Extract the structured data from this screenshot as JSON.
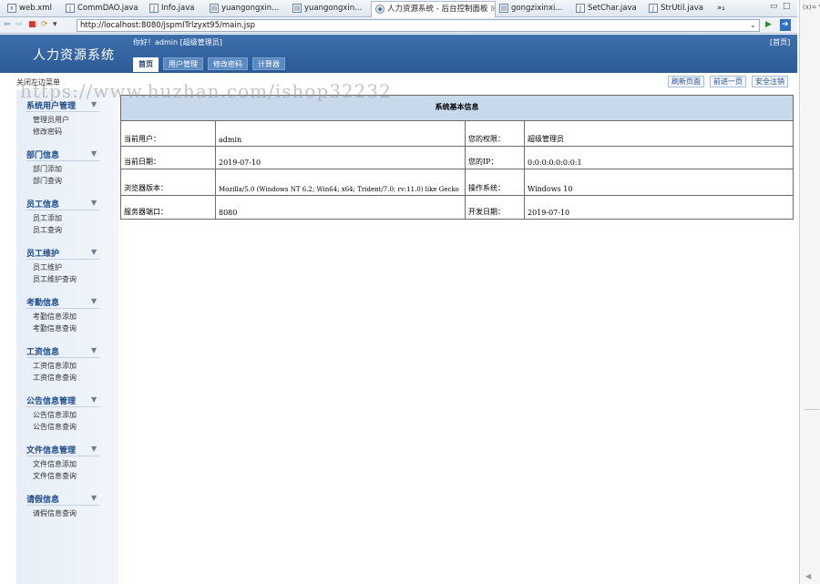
{
  "editor_tabs": [
    {
      "label": "web.xml",
      "icon": "x-icon"
    },
    {
      "label": "CommDAO.java",
      "icon": "j-icon"
    },
    {
      "label": "Info.java",
      "icon": "j-icon"
    },
    {
      "label": "yuangongxin...",
      "icon": "file-icon"
    },
    {
      "label": "yuangongxin...",
      "icon": "file-icon"
    },
    {
      "label": "人力资源系统 - 后台控制面板",
      "icon": "globe-icon",
      "active": true
    },
    {
      "label": "gongzixinxi...",
      "icon": "file-icon"
    },
    {
      "label": "SetChar.java",
      "icon": "j-icon"
    },
    {
      "label": "StrUtil.java",
      "icon": "j-icon"
    },
    {
      "label": "»₂",
      "icon": ""
    }
  ],
  "right_panel_label": "(x)= V",
  "address": {
    "url": "http://localhost:8080/jspmITrlzyxt95/main.jsp"
  },
  "header": {
    "brand": "人力资源系统",
    "greeting": "你好！admin [超级管理员]",
    "home_link": "[首页]",
    "nav_tabs": [
      "首页",
      "用户管理",
      "修改密码",
      "计算器"
    ]
  },
  "utility": {
    "close_menu": "关闭左边菜单",
    "refresh": "刷新页面",
    "back": "前进一页",
    "logout": "安全注销"
  },
  "watermark": "https://www.huzhan.com/ishop32232",
  "sidebar": [
    {
      "title": "系统用户管理",
      "items": [
        "管理员用户",
        "修改密码"
      ]
    },
    {
      "title": "部门信息",
      "items": [
        "部门添加",
        "部门查询"
      ]
    },
    {
      "title": "员工信息",
      "items": [
        "员工添加",
        "员工查询"
      ]
    },
    {
      "title": "员工维护",
      "items": [
        "员工维护",
        "员工维护查询"
      ]
    },
    {
      "title": "考勤信息",
      "items": [
        "考勤信息添加",
        "考勤信息查询"
      ]
    },
    {
      "title": "工资信息",
      "items": [
        "工资信息添加",
        "工资信息查询"
      ]
    },
    {
      "title": "公告信息管理",
      "items": [
        "公告信息添加",
        "公告信息查询"
      ]
    },
    {
      "title": "文件信息管理",
      "items": [
        "文件信息添加",
        "文件信息查询"
      ]
    },
    {
      "title": "请假信息",
      "items": [
        "请假信息查询"
      ]
    }
  ],
  "info": {
    "title": "系统基本信息",
    "rows": [
      {
        "k1": "当前用户：",
        "v1": "admin",
        "k2": "您的权限：",
        "v2": "超级管理员"
      },
      {
        "k1": "当前日期：",
        "v1": "2019-07-10",
        "k2": "您的IP：",
        "v2": "0:0:0:0:0:0:0:1"
      },
      {
        "k1": "浏览器版本：",
        "v1": "Mozilla/5.0 (Windows NT 6.2; Win64; x64; Trident/7.0; rv:11.0) like Gecko",
        "k2": "操作系统：",
        "v2": "Windows 10"
      },
      {
        "k1": "服务器端口：",
        "v1": "8080",
        "k2": "开发日期：",
        "v2": "2019-07-10"
      }
    ]
  }
}
